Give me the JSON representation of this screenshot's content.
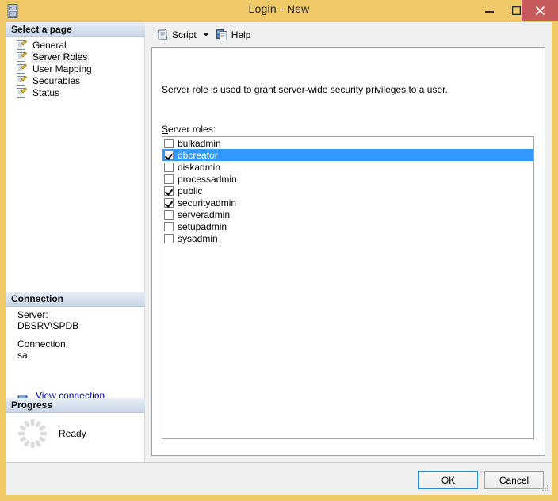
{
  "window": {
    "title": "Login - New",
    "icon": "server-rack-icon",
    "controls": {
      "minimize": "minimize-icon",
      "maximize": "maximize-icon",
      "close": "close-icon"
    },
    "close_color": "#c75b5b",
    "titlebar_color": "#f0c968"
  },
  "sidebar": {
    "header": "Select a page",
    "items": [
      {
        "label": "General",
        "icon": "page-property-icon",
        "selected": false
      },
      {
        "label": "Server Roles",
        "icon": "page-property-icon",
        "selected": true
      },
      {
        "label": "User Mapping",
        "icon": "page-property-icon",
        "selected": false
      },
      {
        "label": "Securables",
        "icon": "page-property-icon",
        "selected": false
      },
      {
        "label": "Status",
        "icon": "page-property-icon",
        "selected": false
      }
    ]
  },
  "connection": {
    "header": "Connection",
    "server_label": "Server:",
    "server_value": "DBSRV\\SPDB",
    "connection_label": "Connection:",
    "connection_value": "sa",
    "link_label": "View connection properties",
    "link_icon": "server-connection-icon",
    "link_color": "#0000cc"
  },
  "progress": {
    "header": "Progress",
    "status": "Ready",
    "spinner_icon": "loading-spinner-icon"
  },
  "toolbar": {
    "script_label": "Script",
    "script_icon": "script-scroll-icon",
    "script_caret_icon": "chevron-down-icon",
    "help_label": "Help",
    "help_icon": "help-pages-icon"
  },
  "main": {
    "description": "Server role is used to grant server-wide security privileges to a user.",
    "roles_label_accesskey": "S",
    "roles_label_rest": "erver roles:",
    "roles": [
      {
        "name": "bulkadmin",
        "checked": false,
        "selected": false
      },
      {
        "name": "dbcreator",
        "checked": true,
        "selected": true
      },
      {
        "name": "diskadmin",
        "checked": false,
        "selected": false
      },
      {
        "name": "processadmin",
        "checked": false,
        "selected": false
      },
      {
        "name": "public",
        "checked": true,
        "selected": false
      },
      {
        "name": "securityadmin",
        "checked": true,
        "selected": false
      },
      {
        "name": "serveradmin",
        "checked": false,
        "selected": false
      },
      {
        "name": "setupadmin",
        "checked": false,
        "selected": false
      },
      {
        "name": "sysadmin",
        "checked": false,
        "selected": false
      }
    ],
    "selection_color": "#3399ff"
  },
  "footer": {
    "ok_label": "OK",
    "cancel_label": "Cancel",
    "grip_icon": "resize-grip-icon"
  }
}
